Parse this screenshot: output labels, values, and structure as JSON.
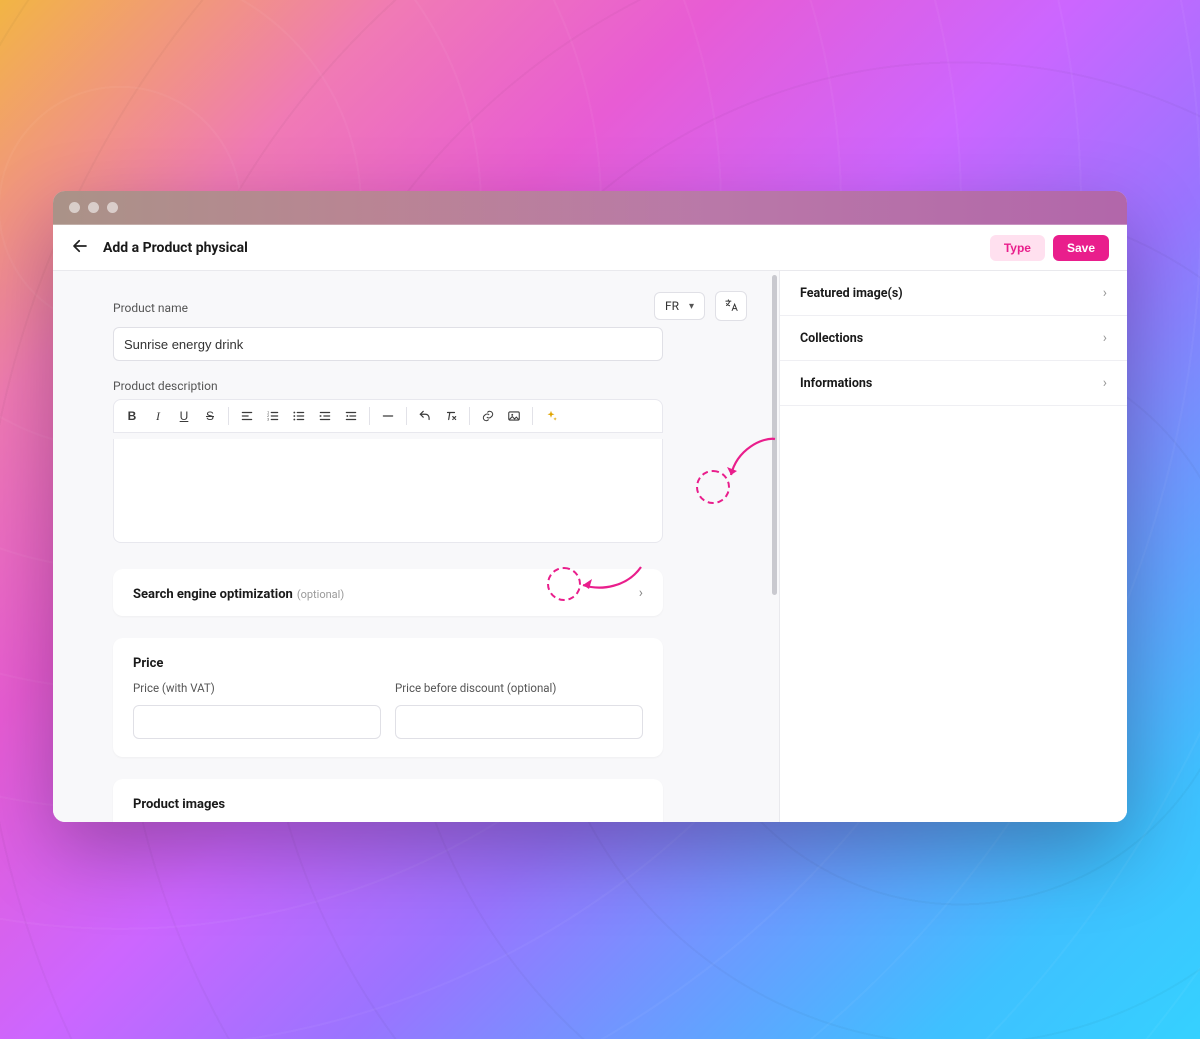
{
  "header": {
    "title": "Add a Product physical",
    "type_button": "Type",
    "save_button": "Save"
  },
  "form": {
    "product_name_label": "Product name",
    "product_name_value": "Sunrise energy drink",
    "language_selected": "FR",
    "description_label": "Product description"
  },
  "seo": {
    "title": "Search engine optimization",
    "optional": "(optional)"
  },
  "price": {
    "title": "Price",
    "with_vat_label": "Price (with VAT)",
    "before_discount_label": "Price before discount (optional)",
    "with_vat_value": "",
    "before_discount_value": ""
  },
  "images": {
    "title": "Product images"
  },
  "sidebar": {
    "items": [
      {
        "label": "Featured image(s)"
      },
      {
        "label": "Collections"
      },
      {
        "label": "Informations"
      }
    ]
  },
  "editor_icons": [
    "bold",
    "italic",
    "underline",
    "strike",
    "sep",
    "align",
    "ol",
    "ul",
    "indent",
    "outdent",
    "sep",
    "hr",
    "sep",
    "undo",
    "clear",
    "sep",
    "link",
    "img",
    "sep",
    "ai"
  ]
}
